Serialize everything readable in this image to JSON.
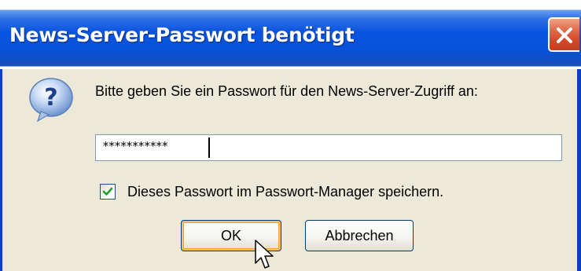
{
  "dialog": {
    "title": "News-Server-Passwort benötigt",
    "prompt": "Bitte geben Sie ein Passwort für den News-Server-Zugriff an:",
    "password_value": "***********",
    "remember_label": "Dieses Passwort im Passwort-Manager speichern.",
    "remember_checked": true,
    "ok_label": "OK",
    "cancel_label": "Abbrechen"
  },
  "icons": {
    "dialog_icon": "question-icon",
    "close": "close-icon",
    "pointer": "mouse-pointer-icon"
  },
  "colors": {
    "titlebar": "#0a55e0",
    "close_button": "#d2482a",
    "dialog_background": "#ece9d8",
    "default_button_highlight": "#f7c160"
  }
}
